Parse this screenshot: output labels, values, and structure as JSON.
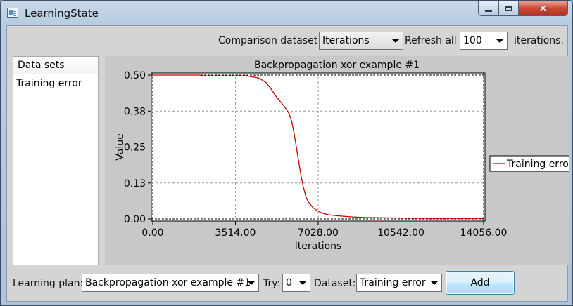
{
  "window": {
    "title": "LearningState",
    "icon": "app-window-icon",
    "controls": {
      "minimize": "minimize-icon",
      "maximize": "maximize-icon",
      "close": "✕"
    }
  },
  "toolbar": {
    "comparison_label": "Comparison dataset",
    "comparison_value": "Iterations",
    "refresh_label": "Refresh all",
    "refresh_value": "100",
    "iterations_label": "iterations."
  },
  "datasets_panel": {
    "header": "Data sets",
    "items": [
      "Training error"
    ]
  },
  "chart_data": {
    "type": "line",
    "title": "Backpropagation xor example #1",
    "xlabel": "Iterations",
    "ylabel": "Value",
    "xlim": [
      0,
      14056
    ],
    "ylim": [
      0,
      0.5
    ],
    "x_ticks": [
      "0.00",
      "3514.00",
      "7028.00",
      "10542.00",
      "14056.00"
    ],
    "y_ticks": [
      "0.00",
      "0.13",
      "0.25",
      "0.38",
      "0.50"
    ],
    "grid": true,
    "legend_position": "right",
    "series": [
      {
        "name": "Training error",
        "color": "#cc0000",
        "x": [
          0,
          1000,
          2000,
          2100,
          3000,
          4000,
          4500,
          4800,
          5000,
          5200,
          5400,
          5600,
          5800,
          5900,
          6000,
          6100,
          6200,
          6300,
          6400,
          6500,
          6600,
          6800,
          7000,
          7200,
          7500,
          8000,
          8500,
          9000,
          10000,
          11000,
          12000,
          13000,
          14056
        ],
        "y": [
          0.5,
          0.5,
          0.5,
          0.497,
          0.497,
          0.497,
          0.49,
          0.475,
          0.455,
          0.43,
          0.41,
          0.39,
          0.365,
          0.34,
          0.3,
          0.25,
          0.2,
          0.15,
          0.11,
          0.08,
          0.06,
          0.04,
          0.028,
          0.02,
          0.014,
          0.01,
          0.007,
          0.005,
          0.004,
          0.003,
          0.002,
          0.002,
          0.002
        ]
      }
    ]
  },
  "bottombar": {
    "plan_label": "Learning plan:",
    "plan_value": "Backpropagation xor example #1",
    "try_label": "Try:",
    "try_value": "0",
    "dataset_label": "Dataset:",
    "dataset_value": "Training error",
    "add_label": "Add"
  }
}
